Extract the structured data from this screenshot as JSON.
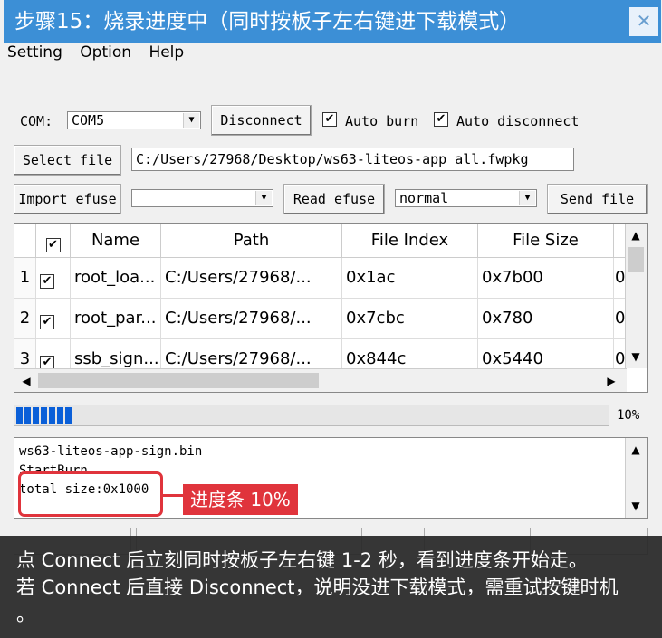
{
  "title_overlay": "步骤15：烧录进度中（同时按板子左右键进下载模式）",
  "close_glyph": "✕",
  "menu": [
    "Setting",
    "Option",
    "Help"
  ],
  "com": {
    "label": "COM:",
    "value": "COM5"
  },
  "buttons": {
    "disconnect": "Disconnect",
    "select_file": "Select file",
    "import_efuse": "Import efuse",
    "read_efuse": "Read efuse",
    "send_file": "Send file"
  },
  "checkboxes": {
    "auto_burn": "Auto burn",
    "auto_disconnect": "Auto disconnect"
  },
  "file_path": "C:/Users/27968/Desktop/ws63-liteos-app_all.fwpkg",
  "efuse_dropdown": "",
  "mode_dropdown": "normal",
  "table": {
    "headers": [
      "Name",
      "Path",
      "File Index",
      "File Size"
    ],
    "rows": [
      {
        "num": "1",
        "name": "root_loa...",
        "path": "C:/Users/27968/...",
        "index": "0x1ac",
        "size": "0x7b00",
        "more": "0"
      },
      {
        "num": "2",
        "name": "root_par...",
        "path": "C:/Users/27968/...",
        "index": "0x7cbc",
        "size": "0x780",
        "more": "0"
      },
      {
        "num": "3",
        "name": "ssb_sign....",
        "path": "C:/Users/27968/...",
        "index": "0x844c",
        "size": "0x5440",
        "more": "0"
      }
    ]
  },
  "progress": {
    "percent_label": "10%",
    "fraction": 0.1
  },
  "log": [
    "ws63-liteos-app-sign.bin",
    "StartBurn",
    "total size:0x1000"
  ],
  "callout": "进度条 10%",
  "caption": {
    "line1": "点 Connect 后立刻同时按板子左右键 1-2 秒，看到进度条开始走。",
    "line2": "若 Connect 后直接 Disconnect，说明没进下载模式，需重试按键时机",
    "line3": "。"
  }
}
